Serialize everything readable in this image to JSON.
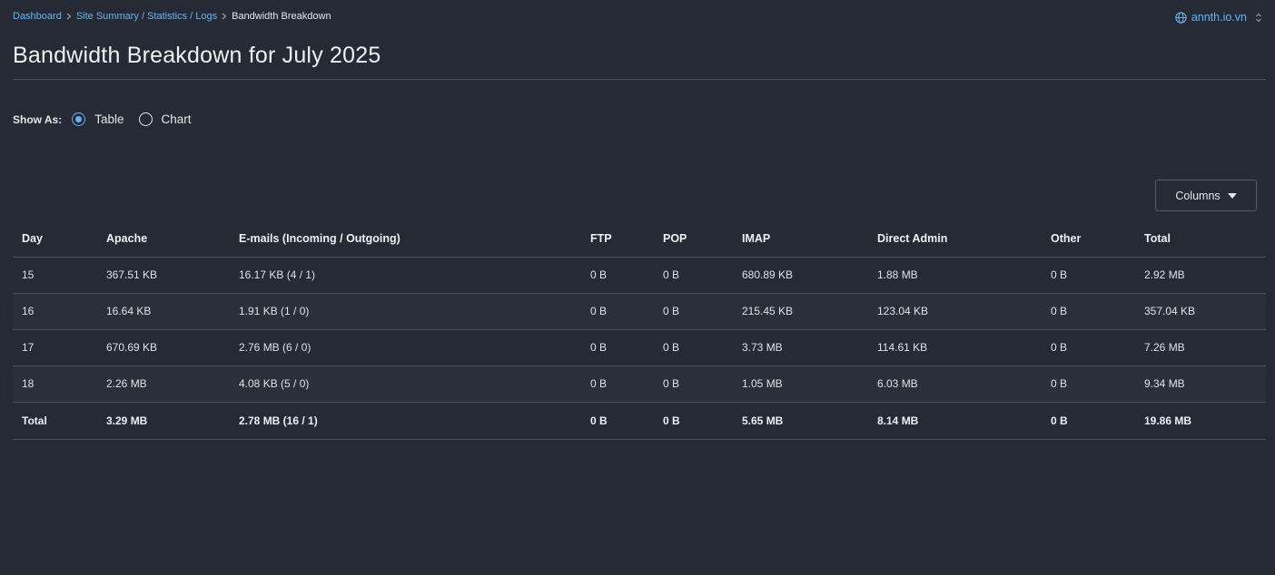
{
  "breadcrumb": {
    "items": [
      "Dashboard",
      "Site Summary / Statistics / Logs"
    ],
    "current": "Bandwidth Breakdown"
  },
  "domain": "annth.io.vn",
  "title": "Bandwidth Breakdown for July 2025",
  "show_as": {
    "label": "Show As:",
    "options": [
      "Table",
      "Chart"
    ],
    "selected": "Table"
  },
  "columns_button": "Columns",
  "table": {
    "headers": [
      "Day",
      "Apache",
      "E-mails (Incoming / Outgoing)",
      "FTP",
      "POP",
      "IMAP",
      "Direct Admin",
      "Other",
      "Total"
    ],
    "rows": [
      [
        "15",
        "367.51 KB",
        "16.17 KB (4 / 1)",
        "0 B",
        "0 B",
        "680.89 KB",
        "1.88 MB",
        "0 B",
        "2.92 MB"
      ],
      [
        "16",
        "16.64 KB",
        "1.91 KB (1 / 0)",
        "0 B",
        "0 B",
        "215.45 KB",
        "123.04 KB",
        "0 B",
        "357.04 KB"
      ],
      [
        "17",
        "670.69 KB",
        "2.76 MB (6 / 0)",
        "0 B",
        "0 B",
        "3.73 MB",
        "114.61 KB",
        "0 B",
        "7.26 MB"
      ],
      [
        "18",
        "2.26 MB",
        "4.08 KB (5 / 0)",
        "0 B",
        "0 B",
        "1.05 MB",
        "6.03 MB",
        "0 B",
        "9.34 MB"
      ]
    ],
    "total": [
      "Total",
      "3.29 MB",
      "2.78 MB (16 / 1)",
      "0 B",
      "0 B",
      "5.65 MB",
      "8.14 MB",
      "0 B",
      "19.86 MB"
    ]
  },
  "colors": {
    "background": "#262a34",
    "accent": "#64b5f6",
    "text": "#e4e6eb",
    "border": "#4a4f5b"
  },
  "icons": {
    "domain": "globe-icon",
    "domain_toggle": "chevron-up-down-icon",
    "breadcrumb_separator": "chevron-right-icon",
    "columns_caret": "caret-down-icon"
  }
}
